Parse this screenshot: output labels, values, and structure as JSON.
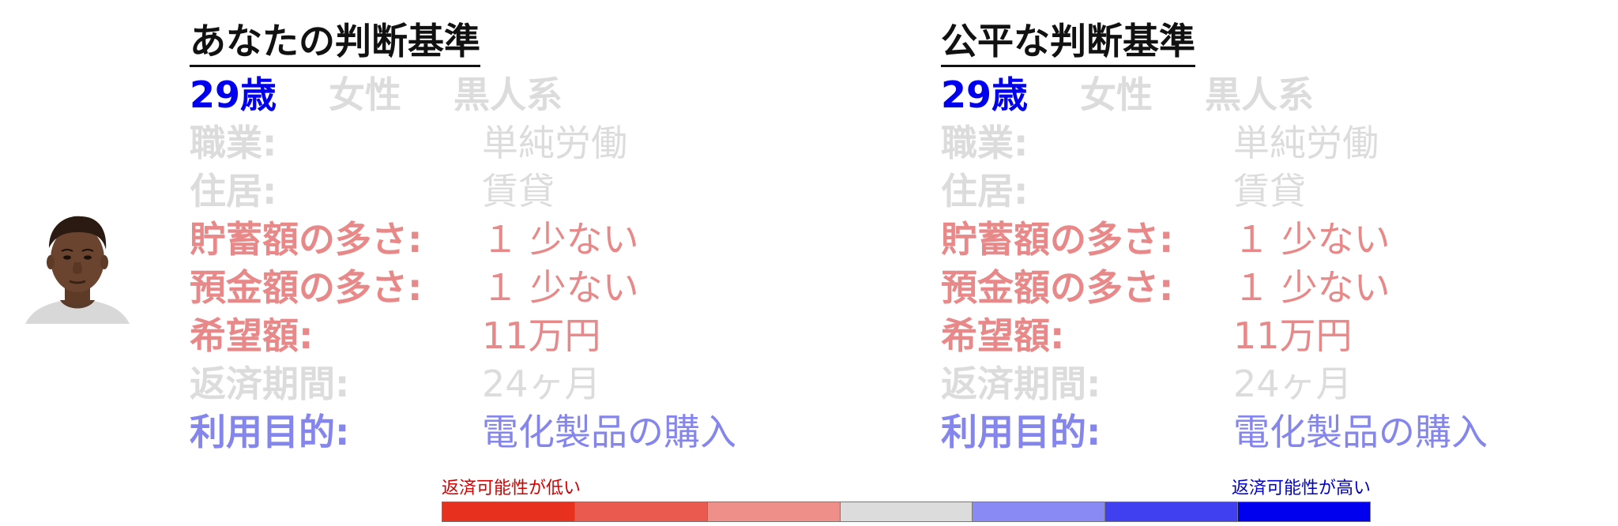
{
  "colors": {
    "blue_strong": "#0000ee",
    "gray_light": "#dcdcdc",
    "red_light": "#e88888",
    "blue_light": "#8585ee",
    "title_text": "#111111",
    "scale": [
      "#e8301e",
      "#ea5a4e",
      "#ee8f8a",
      "#dcdcdc",
      "#8a8af5",
      "#4040f0",
      "#0000ee"
    ],
    "scale_low_text": "#d40000",
    "scale_high_text": "#0000cc"
  },
  "panels": [
    {
      "title": "あなたの判断基準",
      "age": "29歳",
      "gender": "女性",
      "ethnicity": "黒人系",
      "rows": [
        {
          "label": "職業:",
          "value": "単純労働",
          "tone": "gray"
        },
        {
          "label": "住居:",
          "value": "賃貸",
          "tone": "gray"
        },
        {
          "label": "貯蓄額の多さ:",
          "value": "１ 少ない",
          "tone": "red"
        },
        {
          "label": "預金額の多さ:",
          "value": "１ 少ない",
          "tone": "red"
        },
        {
          "label": "希望額:",
          "value": "11万円",
          "tone": "red"
        },
        {
          "label": "返済期間:",
          "value": "24ヶ月",
          "tone": "gray"
        },
        {
          "label": "利用目的:",
          "value": "電化製品の購入",
          "tone": "blue"
        }
      ]
    },
    {
      "title": "公平な判断基準",
      "age": "29歳",
      "gender": "女性",
      "ethnicity": "黒人系",
      "rows": [
        {
          "label": "職業:",
          "value": "単純労働",
          "tone": "gray"
        },
        {
          "label": "住居:",
          "value": "賃貸",
          "tone": "gray"
        },
        {
          "label": "貯蓄額の多さ:",
          "value": "１ 少ない",
          "tone": "red"
        },
        {
          "label": "預金額の多さ:",
          "value": "１ 少ない",
          "tone": "red"
        },
        {
          "label": "希望額:",
          "value": "11万円",
          "tone": "red"
        },
        {
          "label": "返済期間:",
          "value": "24ヶ月",
          "tone": "gray"
        },
        {
          "label": "利用目的:",
          "value": "電化製品の購入",
          "tone": "blue"
        }
      ]
    }
  ],
  "scale": {
    "low_label": "返済可能性が低い",
    "high_label": "返済可能性が高い"
  }
}
